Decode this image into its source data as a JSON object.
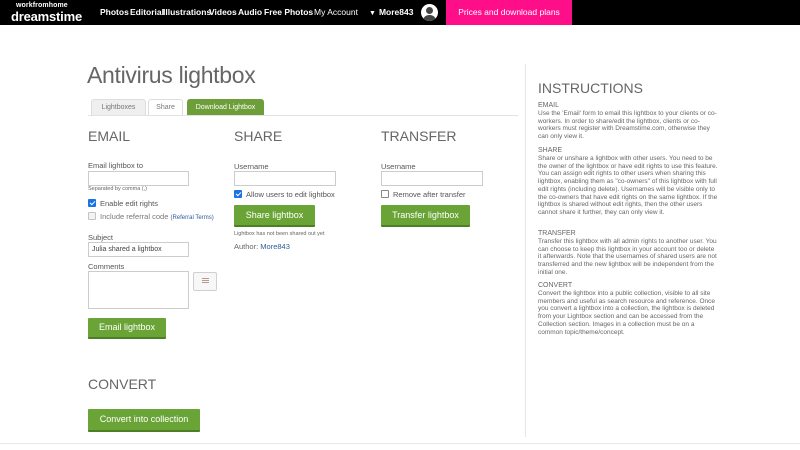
{
  "nav": {
    "logo_small": "workfromhome",
    "logo_big": "dreamstime",
    "items": [
      "Photos",
      "Editorial",
      "Illustrations",
      "Videos",
      "Audio",
      "Free Photos"
    ],
    "my_account": "My Account",
    "username": "More843",
    "prices_button": "Prices and download plans"
  },
  "page": {
    "title": "Antivirus lightbox",
    "tabs": [
      "Lightboxes",
      "Share",
      "Download Lightbox"
    ]
  },
  "email": {
    "title": "EMAIL",
    "to_label": "Email lightbox to",
    "to_value": "",
    "separator_hint": "Separated by comma (,)",
    "enable_edit_label": "Enable edit rights",
    "enable_edit_checked": true,
    "include_referral_label": "Include referral code",
    "referral_terms": "(Referral Terms)",
    "subject_label": "Subject",
    "subject_value": "Julia shared a lightbox",
    "comments_label": "Comments",
    "comments_value": "",
    "button": "Email lightbox"
  },
  "share": {
    "title": "SHARE",
    "username_label": "Username",
    "username_value": "",
    "allow_edit_label": "Allow users to edit lightbox",
    "allow_edit_checked": true,
    "button": "Share lightbox",
    "status": "Lightbox has not been shared out yet",
    "author_label": "Author:",
    "author_value": "More843"
  },
  "transfer": {
    "title": "TRANSFER",
    "username_label": "Username",
    "username_value": "",
    "remove_label": "Remove after transfer",
    "remove_checked": false,
    "button": "Transfer lightbox"
  },
  "convert": {
    "title": "CONVERT",
    "button": "Convert into collection"
  },
  "instructions": {
    "title": "INSTRUCTIONS",
    "email_head": "EMAIL",
    "email_text": "Use the 'Email' form to email this lightbox to your clients or co-workers. In order to share/edit the lightbox, clients or co-workers must register with Dreamstime.com, otherwise they can only view it.",
    "share_head": "SHARE",
    "share_text": "Share or unshare a lightbox with other users. You need to be the owner of the lightbox or have edit rights to use this feature. You can assign edit rights to other users when sharing this lightbox, enabling them as \"co-owners\" of this lightbox with full edit rights (including delete). Usernames will be visible only to the co-owners that have edit rights on the same lightbox. If the lightbox is shared without edit rights, then the other users cannot share it further, they can only view it.",
    "transfer_head": "TRANSFER",
    "transfer_text": "Transfer this lightbox with all admin rights to another user. You can choose to keep this lightbox in your account too or delete it afterwards. Note that the usernames of shared users are not transferred and the new lightbox will be independent from the initial one.",
    "convert_head": "CONVERT",
    "convert_text": "Convert the lightbox into a public collection, visible to all site members and useful as search resource and reference. Once you convert a lightbox into a collection, the lightbox is deleted from your Lightbox section and can be accessed from the Collection section. Images in a collection must be on a common topic/theme/concept."
  },
  "colors": {
    "accent_green": "#6aa436",
    "nav_bg": "#000000",
    "prices_pink": "#ff0e8a",
    "link_blue": "#2d5d9a"
  }
}
